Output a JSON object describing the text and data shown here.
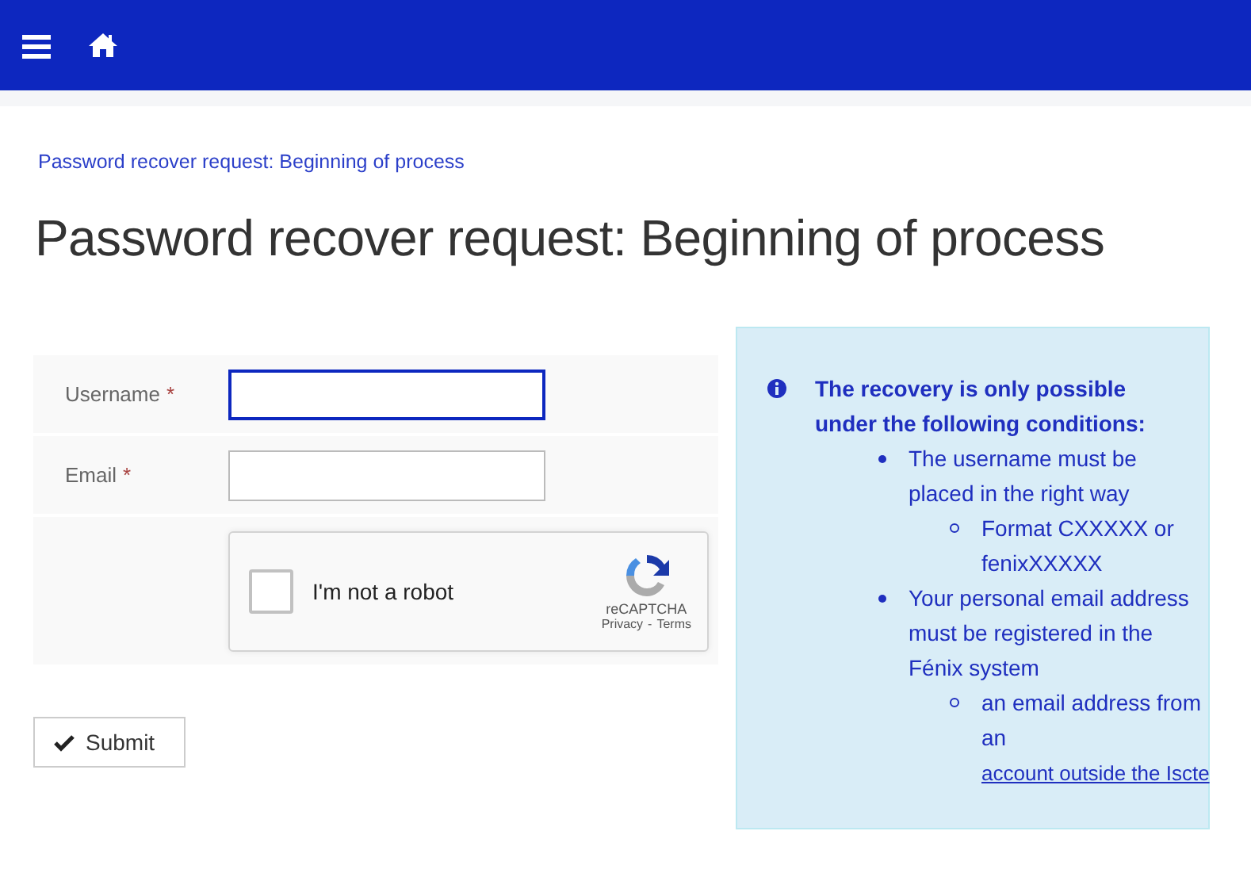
{
  "breadcrumb": "Password recover request: Beginning of process",
  "title": "Password recover request: Beginning of process",
  "form": {
    "fields": [
      {
        "label": "Username",
        "required_mark": "*",
        "focused": true
      },
      {
        "label": "Email",
        "required_mark": "*",
        "focused": false
      }
    ],
    "captcha": {
      "label": "I'm not a robot",
      "checked": false,
      "brand": "reCAPTCHA",
      "privacy": "Privacy",
      "separator": "-",
      "terms": "Terms"
    },
    "submit": "Submit"
  },
  "info": {
    "heading": "The recovery is only possible under the following conditions:",
    "items": [
      {
        "text": "The username must be placed in the right way",
        "children": [
          {
            "text": "Format CXXXXX or fenixXXXXX"
          }
        ]
      },
      {
        "text": "Your personal email address must be registered in the Fénix system",
        "children": [
          {
            "text": "an email address from an",
            "link": "account outside the Iscte"
          }
        ]
      }
    ]
  }
}
